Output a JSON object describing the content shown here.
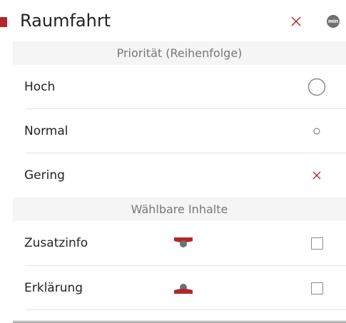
{
  "window": {
    "title": "Raumfahrt",
    "min_label": "min"
  },
  "icons": {
    "marker": "red-square-marker",
    "close": "close-x-icon",
    "min": "min-circle-icon",
    "priority_high": "large-circle-icon",
    "priority_normal": "small-circle-icon",
    "priority_low": "x-mark-icon",
    "zusatzinfo": "info-flag-icon",
    "erklaerung": "explanation-flag-icon",
    "checkbox": "checkbox-icon"
  },
  "colors": {
    "accent_red": "#b3262d",
    "min_gray": "#707070",
    "section_bg": "#f5f5f5",
    "divider": "#e4e4e4",
    "text": "#222222",
    "muted_text": "#777777",
    "circle_gray": "#8a8a8a"
  },
  "sections": {
    "priority": {
      "header": "Priorität (Reihenfolge)",
      "items": [
        {
          "label": "Hoch"
        },
        {
          "label": "Normal"
        },
        {
          "label": "Gering"
        }
      ]
    },
    "content": {
      "header": "Wählbare Inhalte",
      "items": [
        {
          "label": "Zusatzinfo",
          "checked": false
        },
        {
          "label": "Erklärung",
          "checked": false
        }
      ]
    }
  }
}
